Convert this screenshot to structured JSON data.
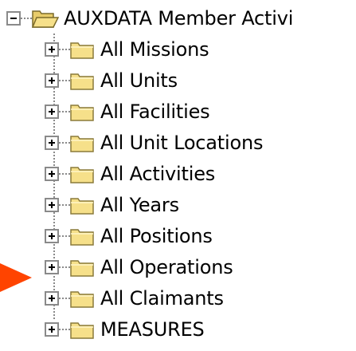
{
  "tree": {
    "root": {
      "label": "AUXDATA Member Activi",
      "expanded": true
    },
    "items": [
      {
        "label": "All Missions"
      },
      {
        "label": "All Units"
      },
      {
        "label": "All Facilities"
      },
      {
        "label": "All Unit Locations"
      },
      {
        "label": "All Activities"
      },
      {
        "label": "All Years"
      },
      {
        "label": "All Positions"
      },
      {
        "label": "All Operations"
      },
      {
        "label": "All Claimants"
      },
      {
        "label": "MEASURES"
      }
    ]
  },
  "colors": {
    "folder_fill": "#f6e08a",
    "folder_stroke": "#8a7a3a",
    "open_folder_fill": "#f6e08a",
    "arrow": "#ff4400",
    "connector": "#8a8a8a"
  },
  "icons": {
    "expander_collapsed": "plus-box-icon",
    "expander_expanded": "minus-box-icon",
    "node": "folder-icon",
    "root_node": "open-folder-icon",
    "pointer": "pointer-arrow-icon"
  }
}
